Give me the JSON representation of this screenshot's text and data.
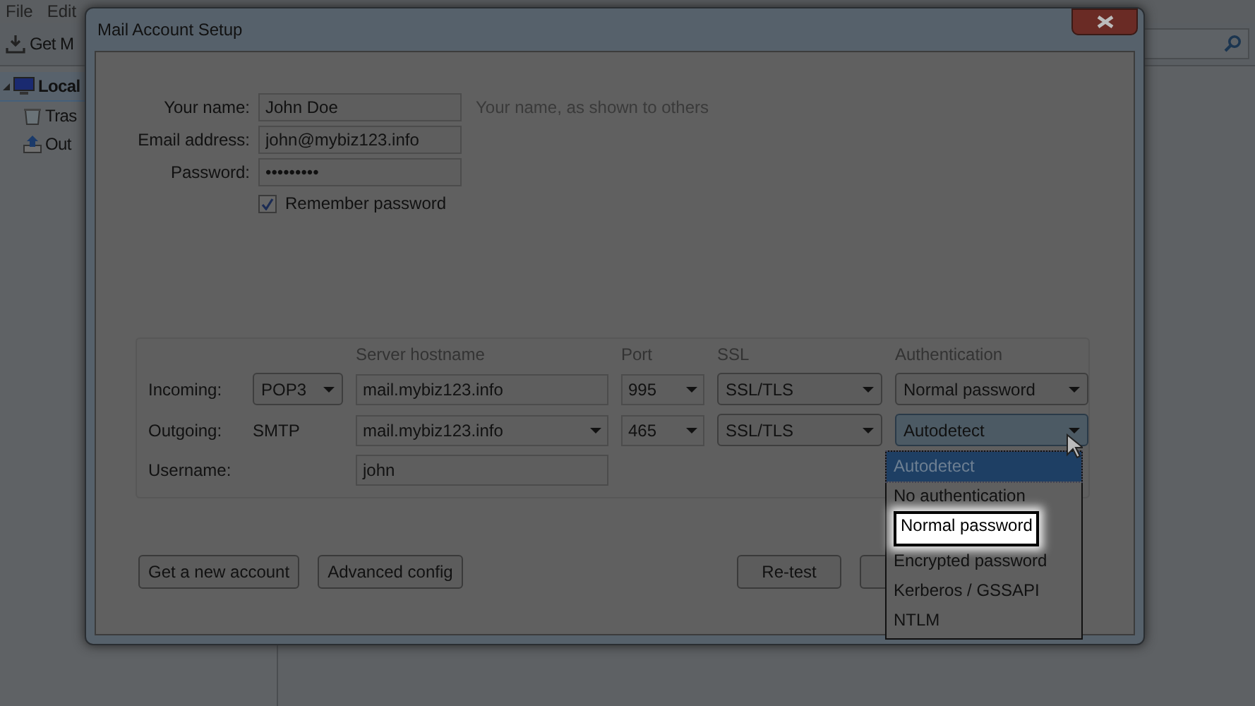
{
  "background_app": {
    "menu": [
      "File",
      "Edit"
    ],
    "toolbar_button": "Get M",
    "folders": [
      {
        "label": "Local",
        "expanded": true,
        "children": [
          {
            "label": "Tras",
            "kind": "trash"
          },
          {
            "label": "Out",
            "kind": "outbox"
          }
        ]
      }
    ]
  },
  "dialog": {
    "title": "Mail Account Setup",
    "fields": [
      {
        "label": "Your name:",
        "value": "John Doe",
        "hint": "Your name, as shown to others"
      },
      {
        "label": "Email address:",
        "value": "john@mybiz123.info"
      },
      {
        "label": "Password:",
        "value": "•••••••••"
      }
    ],
    "remember_password": {
      "label": "Remember password",
      "checked": true
    },
    "server_settings": {
      "columns": [
        "Server hostname",
        "Port",
        "SSL",
        "Authentication"
      ],
      "rows": [
        {
          "label": "Incoming:",
          "kind": "select",
          "protocol": "POP3",
          "hostname": "mail.mybiz123.info",
          "hostname_dropdown": false,
          "port": "995",
          "ssl": "SSL/TLS",
          "authentication": "Normal password",
          "focused": false
        },
        {
          "label": "Outgoing:",
          "kind": "text",
          "protocol": "SMTP",
          "hostname": "mail.mybiz123.info",
          "hostname_dropdown": true,
          "port": "465",
          "ssl": "SSL/TLS",
          "authentication": "Autodetect",
          "focused": true
        }
      ],
      "username": {
        "label": "Username:",
        "value": "john"
      }
    },
    "left_buttons": [
      "Get a new account",
      "Advanced config"
    ],
    "right_buttons": [
      "Re-test"
    ],
    "auth_dropdown": [
      {
        "label": "Autodetect",
        "selected": true,
        "highlighted": false
      },
      {
        "label": "No authentication",
        "selected": false,
        "highlighted": false
      },
      {
        "label": "Normal password",
        "selected": false,
        "highlighted": true
      },
      {
        "label": "Encrypted password",
        "selected": false,
        "highlighted": false
      },
      {
        "label": "Kerberos / GSSAPI",
        "selected": false,
        "highlighted": false
      },
      {
        "label": "NTLM",
        "selected": false,
        "highlighted": false
      }
    ]
  }
}
